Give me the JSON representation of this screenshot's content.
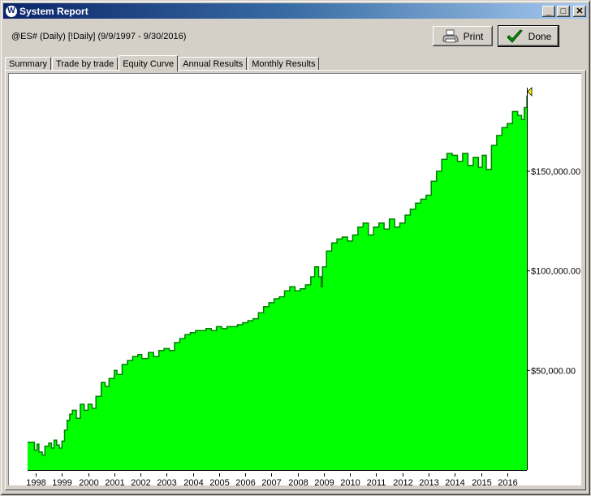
{
  "window": {
    "title": "System Report",
    "app_icon": "W",
    "controls": {
      "minimize": "_",
      "maximize": "□",
      "close": "✕"
    }
  },
  "header": {
    "subtitle": "@ES# (Daily) [!Daily]  (9/9/1997 - 9/30/2016)",
    "print_label": "Print",
    "done_label": "Done"
  },
  "tabs": [
    {
      "label": "Summary",
      "active": false
    },
    {
      "label": "Trade by trade",
      "active": false
    },
    {
      "label": "Equity Curve",
      "active": true
    },
    {
      "label": "Annual Results",
      "active": false
    },
    {
      "label": "Monthly Results",
      "active": false
    }
  ],
  "colors": {
    "fill": "#00ff00",
    "line": "#008000",
    "marker": "#ffff00"
  },
  "chart_data": {
    "type": "area",
    "title": "Equity Curve",
    "xlabel": "",
    "ylabel": "",
    "x_range": [
      1997.69,
      2016.75
    ],
    "ylim": [
      0,
      192000
    ],
    "grid": false,
    "y_axis_position": "right",
    "x_ticks": [
      "1998",
      "1999",
      "2000",
      "2001",
      "2002",
      "2003",
      "2004",
      "2005",
      "2006",
      "2007",
      "2008",
      "2009",
      "2010",
      "2011",
      "2012",
      "2013",
      "2014",
      "2015",
      "2016"
    ],
    "y_ticks": [
      {
        "value": 50000,
        "label": "$50,000.00"
      },
      {
        "value": 100000,
        "label": "$100,000.00"
      },
      {
        "value": 150000,
        "label": "$150,000.00"
      }
    ],
    "x": [
      1997.69,
      1997.9,
      1997.95,
      1998.05,
      1998.12,
      1998.25,
      1998.35,
      1998.5,
      1998.6,
      1998.7,
      1998.8,
      1998.9,
      1999.0,
      1999.1,
      1999.2,
      1999.3,
      1999.4,
      1999.55,
      1999.7,
      1999.85,
      2000.0,
      2000.15,
      2000.3,
      2000.5,
      2000.65,
      2000.8,
      2001.0,
      2001.1,
      2001.3,
      2001.5,
      2001.7,
      2001.9,
      2002.05,
      2002.3,
      2002.5,
      2002.7,
      2002.9,
      2003.1,
      2003.3,
      2003.5,
      2003.7,
      2003.9,
      2004.1,
      2004.3,
      2004.5,
      2004.7,
      2004.9,
      2005.1,
      2005.3,
      2005.5,
      2005.7,
      2005.9,
      2006.1,
      2006.3,
      2006.5,
      2006.7,
      2006.9,
      2007.1,
      2007.3,
      2007.5,
      2007.7,
      2007.9,
      2008.1,
      2008.3,
      2008.5,
      2008.65,
      2008.8,
      2008.9,
      2008.95,
      2009.1,
      2009.3,
      2009.5,
      2009.7,
      2009.9,
      2010.1,
      2010.3,
      2010.5,
      2010.7,
      2010.9,
      2011.1,
      2011.3,
      2011.5,
      2011.7,
      2011.9,
      2012.1,
      2012.3,
      2012.5,
      2012.7,
      2012.9,
      2013.1,
      2013.3,
      2013.5,
      2013.7,
      2013.9,
      2014.1,
      2014.3,
      2014.5,
      2014.7,
      2014.9,
      2015.05,
      2015.2,
      2015.4,
      2015.6,
      2015.8,
      2016.0,
      2016.2,
      2016.4,
      2016.55,
      2016.65,
      2016.75
    ],
    "values": [
      14000,
      14000,
      10000,
      13000,
      9000,
      7500,
      12000,
      13500,
      11000,
      15000,
      12500,
      11000,
      14500,
      20000,
      25000,
      28000,
      30000,
      26000,
      33000,
      30000,
      33000,
      31000,
      37000,
      44000,
      42000,
      46000,
      50000,
      48000,
      53000,
      55000,
      57000,
      58000,
      56000,
      59000,
      57000,
      60000,
      61000,
      60000,
      64000,
      66000,
      68000,
      69000,
      70000,
      70000,
      71000,
      70000,
      72000,
      71000,
      72000,
      72000,
      73000,
      74000,
      75000,
      76000,
      79000,
      82000,
      84000,
      86000,
      87000,
      90000,
      92000,
      90000,
      91000,
      93000,
      97000,
      102000,
      97000,
      92000,
      102000,
      110000,
      114000,
      116000,
      117000,
      115000,
      118000,
      122000,
      124000,
      118000,
      122000,
      124000,
      121000,
      126000,
      122000,
      124000,
      128000,
      131000,
      134000,
      136000,
      138000,
      145000,
      150000,
      156000,
      159000,
      158000,
      155000,
      159000,
      153000,
      157000,
      152000,
      158000,
      151000,
      163000,
      168000,
      172000,
      174000,
      180000,
      178000,
      176000,
      182000,
      188000,
      190000
    ]
  }
}
